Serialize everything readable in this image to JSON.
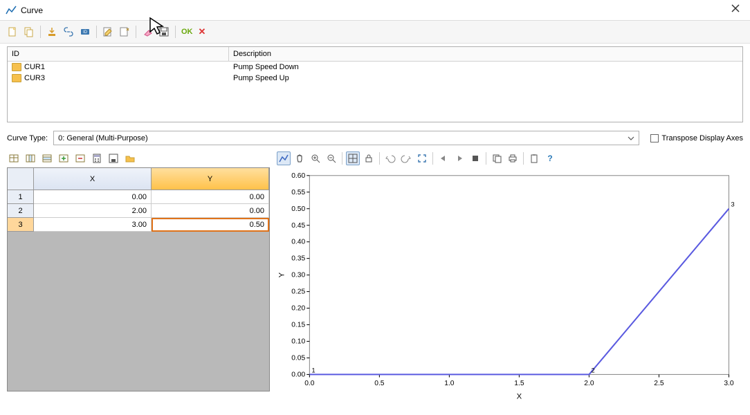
{
  "title": "Curve",
  "toolbar": {
    "ok_label": "OK"
  },
  "listpanel": {
    "head_id": "ID",
    "head_desc": "Description",
    "rows": [
      {
        "id": "CUR1",
        "desc": "Pump Speed Down"
      },
      {
        "id": "CUR3",
        "desc": "Pump Speed Up"
      }
    ]
  },
  "curvetype": {
    "label": "Curve Type:",
    "value": "0: General (Multi-Purpose)"
  },
  "transpose_label": "Transpose Display Axes",
  "grid": {
    "headers": {
      "x": "X",
      "y": "Y"
    },
    "rows": [
      {
        "idx": "1",
        "x": "0.00",
        "y": "0.00"
      },
      {
        "idx": "2",
        "x": "2.00",
        "y": "0.00"
      },
      {
        "idx": "3",
        "x": "3.00",
        "y": "0.50"
      }
    ],
    "selected_cell": "rows.2.y"
  },
  "chart_data": {
    "type": "line",
    "x": [
      0.0,
      2.0,
      3.0
    ],
    "y": [
      0.0,
      0.0,
      0.5
    ],
    "point_labels": [
      "1",
      "2",
      "3"
    ],
    "xlabel": "X",
    "ylabel": "Y",
    "xlim": [
      0.0,
      3.0
    ],
    "ylim": [
      0.0,
      0.6
    ],
    "xticks": [
      0.0,
      0.5,
      1.0,
      1.5,
      2.0,
      2.5,
      3.0
    ],
    "yticks": [
      0.0,
      0.05,
      0.1,
      0.15,
      0.2,
      0.25,
      0.3,
      0.35,
      0.4,
      0.45,
      0.5,
      0.55,
      0.6
    ]
  }
}
